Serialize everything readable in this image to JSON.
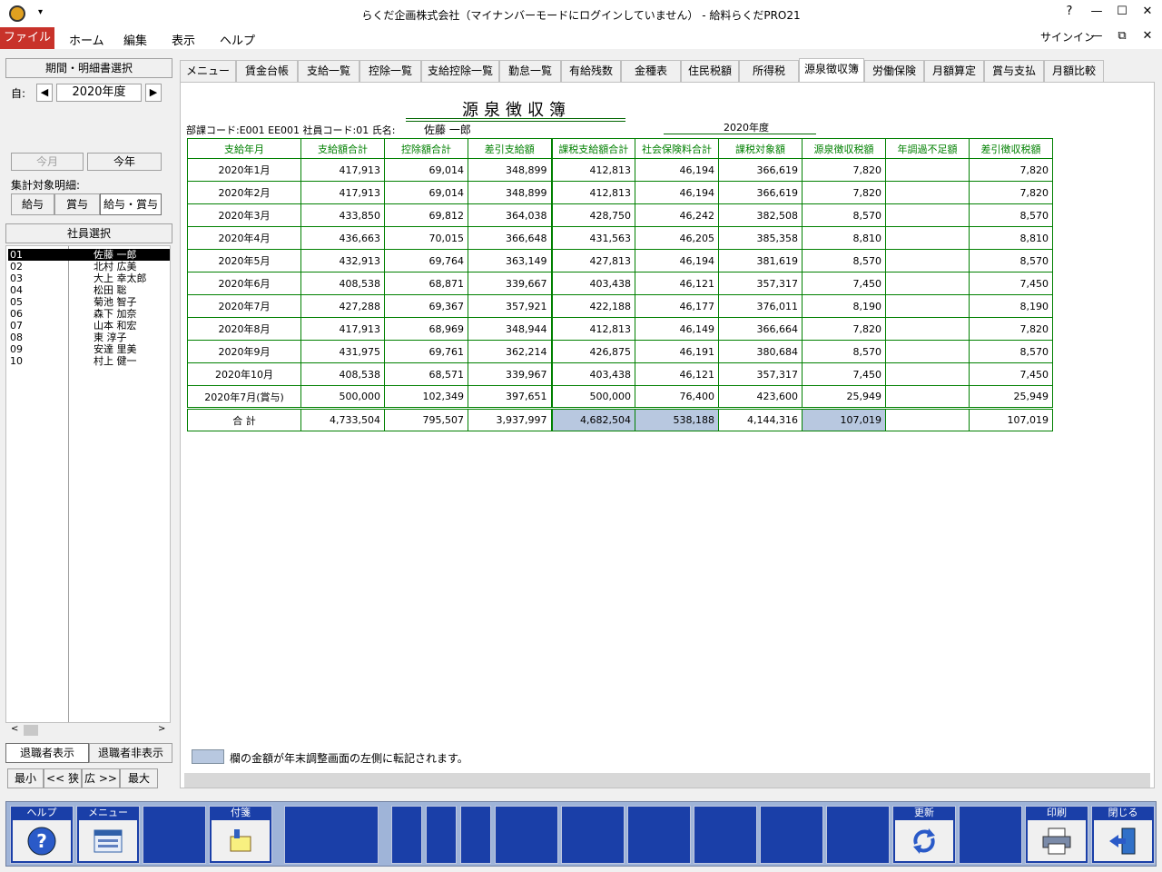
{
  "window": {
    "title": "らくだ企画株式会社（マイナンバーモードにログインしていません） - 給料らくだPRO21",
    "qat_label": "▾",
    "controls": [
      "?",
      "—",
      "☐",
      "✕"
    ],
    "signin": "サインイン",
    "ribbon_controls": [
      "—",
      "⧉",
      "✕"
    ]
  },
  "menu": {
    "file": "ファイル",
    "items": [
      "ホーム",
      "編集",
      "表示",
      "ヘルプ"
    ]
  },
  "left": {
    "period_header": "期間・明細書選択",
    "from_label": "自:",
    "year": "2020年度",
    "this_month": "今月",
    "this_year": "今年",
    "target_label": "集計対象明細:",
    "target_options": [
      "給与",
      "賞与",
      "給与・賞与"
    ],
    "employee_header": "社員選択",
    "employees": [
      {
        "code": "01",
        "name": "佐藤 一郎"
      },
      {
        "code": "02",
        "name": "北村 広美"
      },
      {
        "code": "03",
        "name": "大上 幸太郎"
      },
      {
        "code": "04",
        "name": "松田 聡"
      },
      {
        "code": "05",
        "name": "菊池 智子"
      },
      {
        "code": "06",
        "name": "森下 加奈"
      },
      {
        "code": "07",
        "name": "山本 和宏"
      },
      {
        "code": "08",
        "name": "東 淳子"
      },
      {
        "code": "09",
        "name": "安達 里美"
      },
      {
        "code": "10",
        "name": "村上 健一"
      }
    ],
    "show_retired": "退職者表示",
    "hide_retired": "退職者非表示",
    "zoom_buttons": [
      "最小",
      "<< 狭",
      "広 >>",
      "最大"
    ]
  },
  "tabs": [
    "メニュー",
    "賃金台帳",
    "支給一覧",
    "控除一覧",
    "支給控除一覧",
    "勤怠一覧",
    "有給残数",
    "金種表",
    "住民税額",
    "所得税",
    "源泉徴収簿",
    "労働保険",
    "月額算定",
    "賞与支払",
    "月額比較"
  ],
  "active_tab": "源泉徴収簿",
  "doc": {
    "title": "源泉徴収簿",
    "info": "部課コード:E001 EE001 社員コード:01 氏名:",
    "employee_name": "佐藤 一郎",
    "fiscal_year": "2020年度",
    "columns": [
      "支給年月",
      "支給額合計",
      "控除額合計",
      "差引支給額",
      "課税支給額合計",
      "社会保険料合計",
      "課税対象額",
      "源泉徴収税額",
      "年調過不足額",
      "差引徴収税額"
    ],
    "rows": [
      [
        "2020年1月",
        "417,913",
        "69,014",
        "348,899",
        "412,813",
        "46,194",
        "366,619",
        "7,820",
        "",
        "7,820"
      ],
      [
        "2020年2月",
        "417,913",
        "69,014",
        "348,899",
        "412,813",
        "46,194",
        "366,619",
        "7,820",
        "",
        "7,820"
      ],
      [
        "2020年3月",
        "433,850",
        "69,812",
        "364,038",
        "428,750",
        "46,242",
        "382,508",
        "8,570",
        "",
        "8,570"
      ],
      [
        "2020年4月",
        "436,663",
        "70,015",
        "366,648",
        "431,563",
        "46,205",
        "385,358",
        "8,810",
        "",
        "8,810"
      ],
      [
        "2020年5月",
        "432,913",
        "69,764",
        "363,149",
        "427,813",
        "46,194",
        "381,619",
        "8,570",
        "",
        "8,570"
      ],
      [
        "2020年6月",
        "408,538",
        "68,871",
        "339,667",
        "403,438",
        "46,121",
        "357,317",
        "7,450",
        "",
        "7,450"
      ],
      [
        "2020年7月",
        "427,288",
        "69,367",
        "357,921",
        "422,188",
        "46,177",
        "376,011",
        "8,190",
        "",
        "8,190"
      ],
      [
        "2020年8月",
        "417,913",
        "68,969",
        "348,944",
        "412,813",
        "46,149",
        "366,664",
        "7,820",
        "",
        "7,820"
      ],
      [
        "2020年9月",
        "431,975",
        "69,761",
        "362,214",
        "426,875",
        "46,191",
        "380,684",
        "8,570",
        "",
        "8,570"
      ],
      [
        "2020年10月",
        "408,538",
        "68,571",
        "339,967",
        "403,438",
        "46,121",
        "357,317",
        "7,450",
        "",
        "7,450"
      ],
      [
        "2020年7月(賞与)",
        "500,000",
        "102,349",
        "397,651",
        "500,000",
        "76,400",
        "423,600",
        "25,949",
        "",
        "25,949"
      ]
    ],
    "total": [
      "合 計",
      "4,733,504",
      "795,507",
      "3,937,997",
      "4,682,504",
      "538,188",
      "4,144,316",
      "107,019",
      "",
      "107,019"
    ],
    "legend": "欄の金額が年末調整画面の左側に転記されます。",
    "highlight_color": "#b8c8e0"
  },
  "fkeys": [
    {
      "caption": "ヘルプ",
      "icon": "help-icon"
    },
    {
      "caption": "メニュー",
      "icon": "menu-icon"
    },
    {
      "caption": "",
      "icon": ""
    },
    {
      "caption": "付箋",
      "icon": "sticky-note-icon"
    },
    {
      "caption": "更新",
      "icon": "refresh-icon"
    },
    {
      "caption": "印刷",
      "icon": "printer-icon"
    },
    {
      "caption": "閉じる",
      "icon": "exit-icon"
    }
  ]
}
